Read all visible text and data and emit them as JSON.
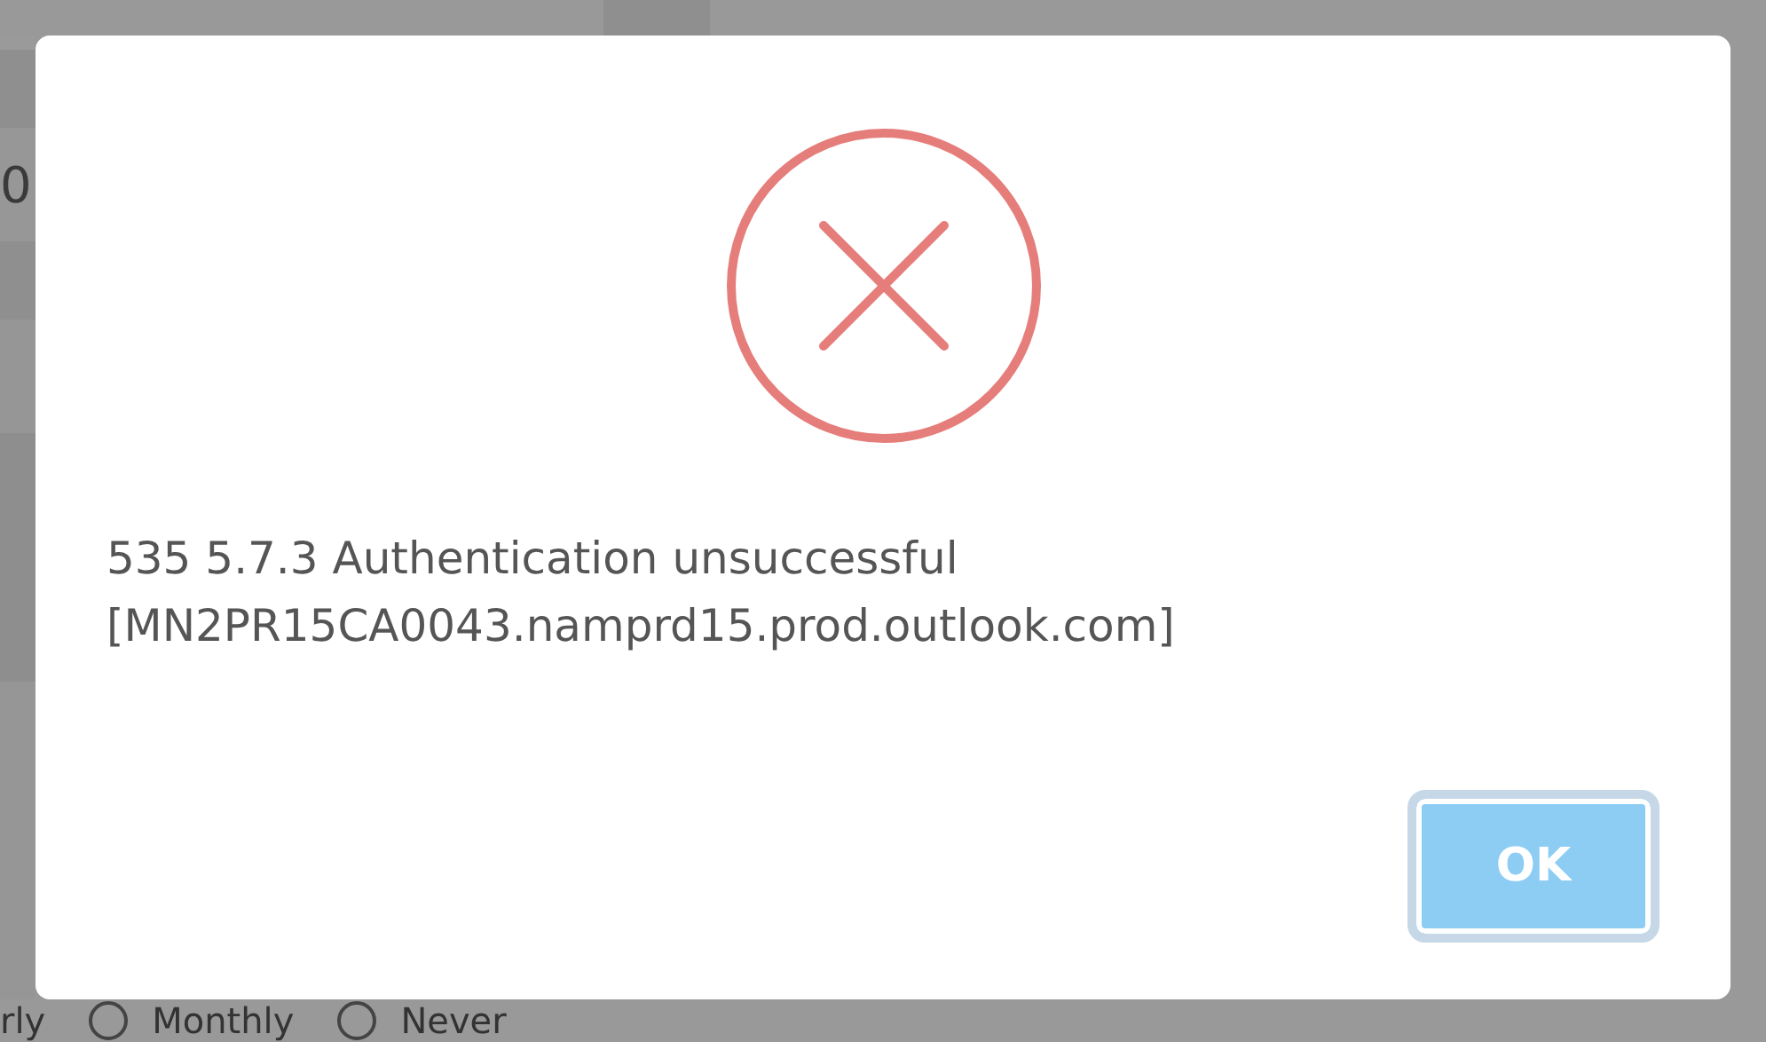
{
  "background": {
    "cell_text": "0",
    "options": [
      {
        "kind": "label",
        "label": "rly"
      },
      {
        "kind": "radio",
        "label": "Monthly",
        "selected": false
      },
      {
        "kind": "radio",
        "label": "Never",
        "selected": false
      }
    ]
  },
  "dialog": {
    "message": "535 5.7.3 Authentication unsuccessful [MN2PR15CA0043.namprd15.prod.outlook.com]",
    "button": "OK"
  }
}
